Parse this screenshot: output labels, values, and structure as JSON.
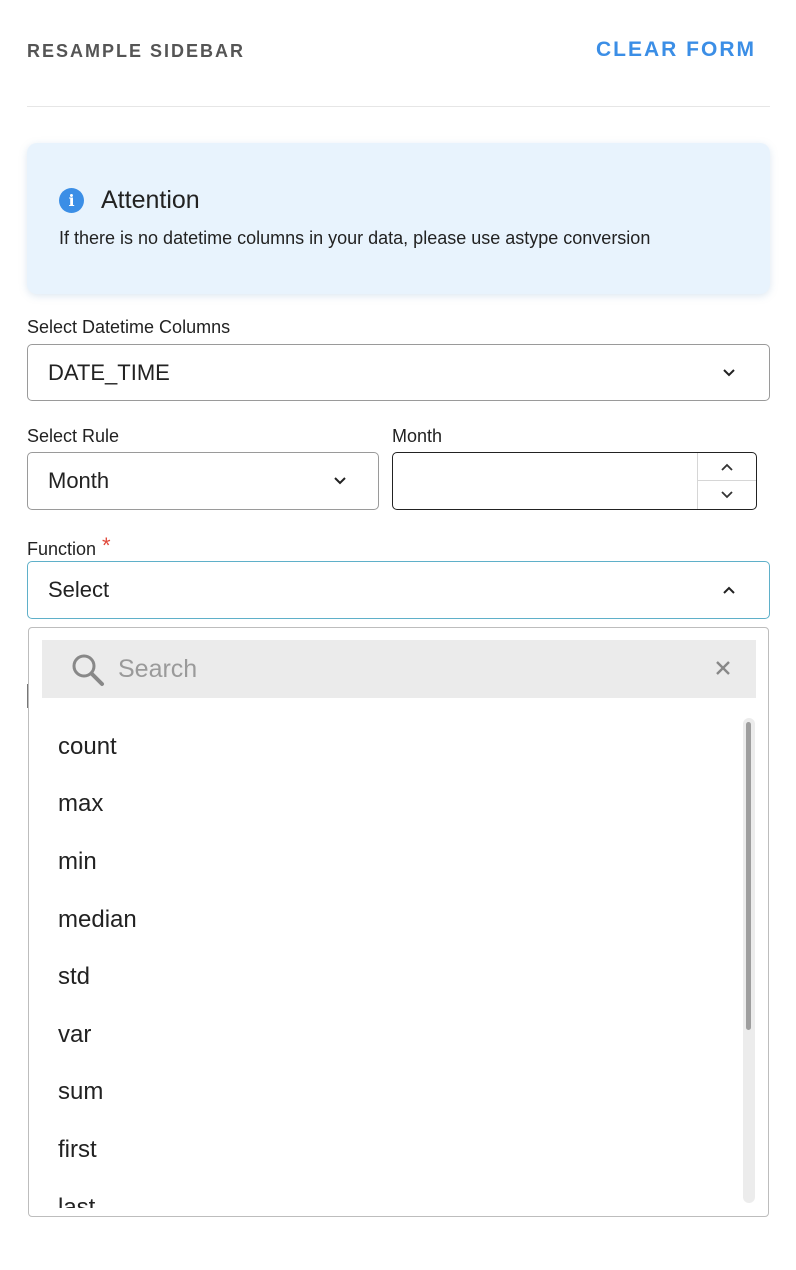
{
  "header": {
    "title": "RESAMPLE SIDEBAR",
    "clear_label": "CLEAR FORM"
  },
  "alert": {
    "title": "Attention",
    "message": "If there is no datetime columns in your data, please use astype conversion",
    "icon": "info-icon",
    "color": "#3b8ee6"
  },
  "datetime": {
    "label": "Select Datetime Columns",
    "value": "DATE_TIME"
  },
  "rule": {
    "label": "Select Rule",
    "value": "Month"
  },
  "month": {
    "label": "Month",
    "value": ""
  },
  "function": {
    "label": "Function",
    "required": "*",
    "value": "Select",
    "search_placeholder": "Search",
    "options": [
      "count",
      "max",
      "min",
      "median",
      "std",
      "var",
      "sum",
      "first",
      "last"
    ]
  },
  "colors": {
    "accent": "#3b8ee6",
    "required": "#e0483a",
    "focus_border": "#5fb0c9"
  }
}
